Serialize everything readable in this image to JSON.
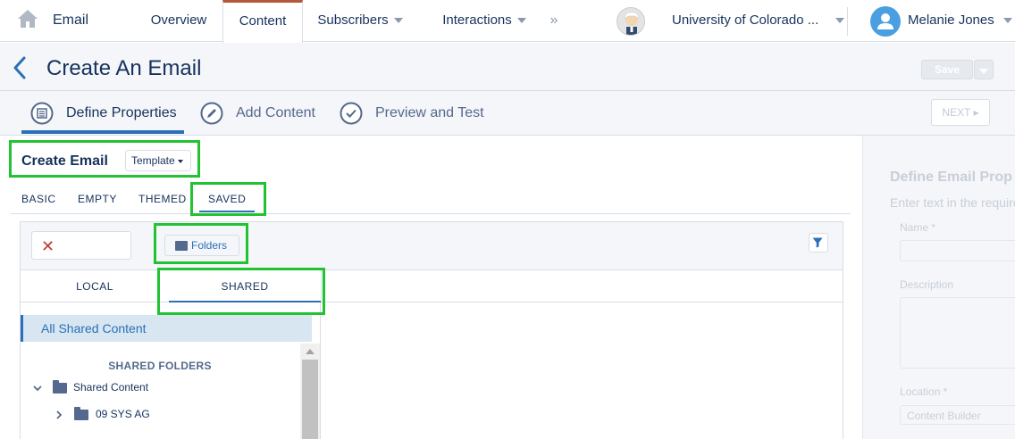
{
  "topnav": {
    "app_name": "Email",
    "items": [
      "Overview",
      "Content",
      "Subscribers",
      "Interactions"
    ],
    "more_glyph": "»",
    "org_name": "University of Colorado ...",
    "user_name": "Melanie Jones",
    "active_item": "Content"
  },
  "page": {
    "title": "Create An Email",
    "save_label": "Save"
  },
  "steps": {
    "items": [
      "Define Properties",
      "Add Content",
      "Preview and Test"
    ],
    "active_index": 0,
    "next_label": "NEXT"
  },
  "main": {
    "title": "Create Email",
    "template_dropdown": "Template",
    "tabs": [
      "BASIC",
      "EMPTY",
      "THEMED",
      "SAVED"
    ],
    "active_tab": "SAVED",
    "clear_glyph": "✕",
    "folders_button": "Folders",
    "subtabs": [
      "LOCAL",
      "SHARED"
    ],
    "active_subtab": "SHARED",
    "all_shared": "All Shared Content",
    "tree": {
      "header": "SHARED FOLDERS",
      "nodes": [
        {
          "label": "Shared Content",
          "expanded": true
        },
        {
          "label": "09 SYS AG",
          "expanded": false
        }
      ]
    }
  },
  "right_panel": {
    "title": "Define Email Prop",
    "hint": "Enter text in the require",
    "name_label": "Name *",
    "description_label": "Description",
    "location_label": "Location *",
    "location_value": "Content Builder"
  },
  "colors": {
    "accent": "#2a6fb8",
    "highlight": "#22c232",
    "active_tab_top": "#b45a3a"
  }
}
